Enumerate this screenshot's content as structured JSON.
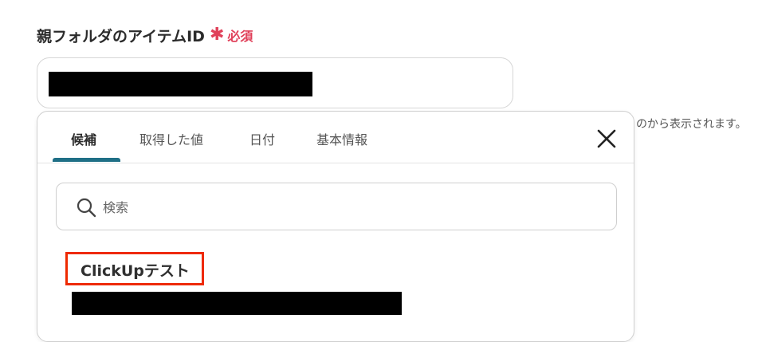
{
  "field": {
    "label": "親フォルダのアイテムID",
    "required_star": "✱",
    "required_text": "必須",
    "helper_text": "のから表示されます。"
  },
  "popup": {
    "tabs": [
      {
        "label": "候補",
        "active": true
      },
      {
        "label": "取得した値",
        "active": false
      },
      {
        "label": "日付",
        "active": false
      },
      {
        "label": "基本情報",
        "active": false
      }
    ],
    "close_icon": "close-icon",
    "search": {
      "placeholder": "検索",
      "icon": "search-icon"
    },
    "option": {
      "title": "ClickUpテスト"
    }
  },
  "colors": {
    "accent": "#1f6f86",
    "required": "#e0415a",
    "highlight": "#ee2a00"
  }
}
